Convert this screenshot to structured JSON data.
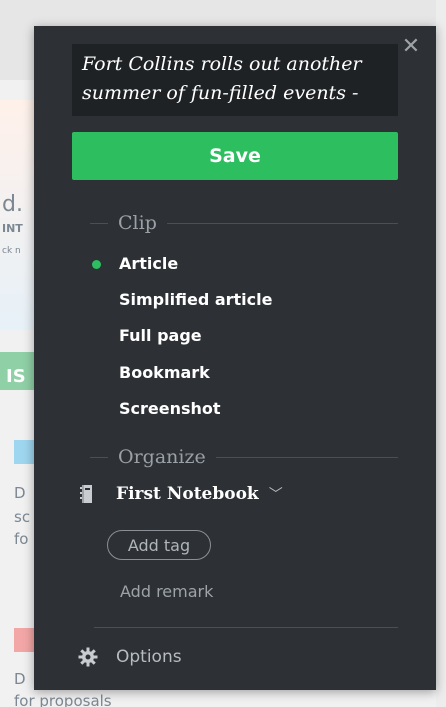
{
  "clipper": {
    "title": "Fort Collins rolls out another summer of fun-filled events -",
    "save_label": "Save",
    "close_symbol": "✕",
    "clip_section_label": "Clip",
    "clip_options": [
      {
        "label": "Article",
        "selected": true
      },
      {
        "label": "Simplified article",
        "selected": false
      },
      {
        "label": "Full page",
        "selected": false
      },
      {
        "label": "Bookmark",
        "selected": false
      },
      {
        "label": "Screenshot",
        "selected": false
      }
    ],
    "organize_section_label": "Organize",
    "notebook": {
      "label": "First Notebook",
      "icon": "notebook-icon",
      "chevron": "﹀"
    },
    "add_tag_label": "Add tag",
    "add_remark_label": "Add remark",
    "options_label": "Options",
    "colors": {
      "accent": "#2dbe60",
      "panel": "#2d3136"
    }
  },
  "background_page": {
    "fragments": [
      "d.",
      "INT",
      "ck n",
      "IS",
      "D",
      "sc",
      "fo",
      "D",
      "for proposals"
    ]
  }
}
